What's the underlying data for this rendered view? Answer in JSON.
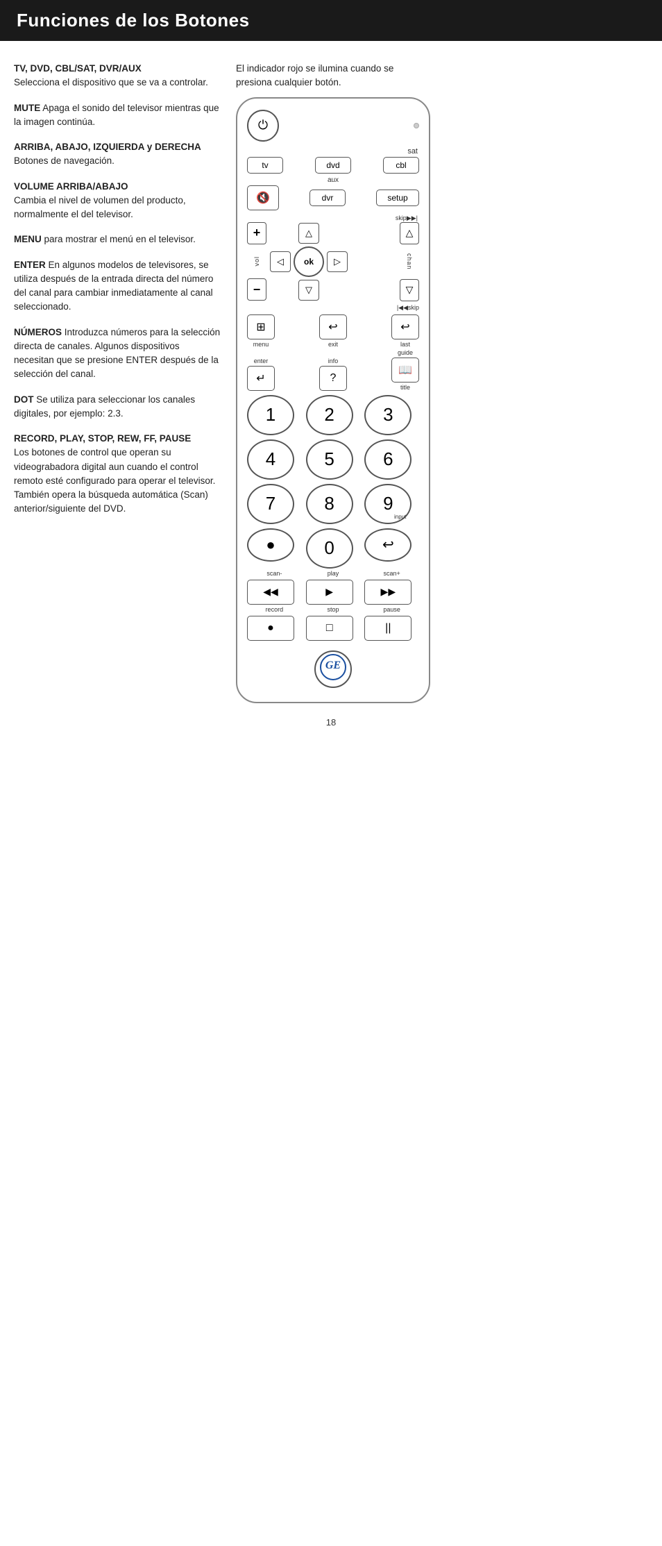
{
  "header": {
    "title": "Funciones de los Botones",
    "bg": "#1a1a1a",
    "color": "#ffffff"
  },
  "indicator_text": "El indicador rojo se ilumina cuando se presiona cualquier botón.",
  "descriptions": [
    {
      "label": "TV, DVD, CBL/SAT, DVR/AUX",
      "text": "Selecciona el dispositivo que se va a controlar."
    },
    {
      "label": "MUTE",
      "text": "Apaga el sonido del televisor mientras que la imagen continúa."
    },
    {
      "label": "ARRIBA, ABAJO, IZQUIERDA y DERECHA",
      "text": "Botones de navegación."
    },
    {
      "label": "VOLUME ARRIBA/ABAJO",
      "text": "Cambia el nivel de volumen del producto, normalmente el del televisor."
    },
    {
      "label": "MENU",
      "text": "para mostrar el menú en el televisor."
    },
    {
      "label": "ENTER",
      "text": "En algunos modelos de televisores, se utiliza después de la entrada directa del número del canal para cambiar inmediatamente al canal seleccionado."
    },
    {
      "label": "NÚMEROS",
      "text": "Introduzca números para la selección directa de canales. Algunos dispositivos necesitan que se presione ENTER después de la selección del canal."
    },
    {
      "label": "DOT",
      "text": "Se utiliza para seleccionar los canales digitales, por ejemplo: 2.3."
    },
    {
      "label": "RECORD, PLAY, STOP, REW, FF, PAUSE",
      "text": "Los botones de control que operan su videograbadora digital aun cuando el control remoto esté configurado para operar el televisor. También opera la búsqueda automática (Scan) anterior/siguiente del DVD."
    }
  ],
  "remote": {
    "power_icon": "⏻",
    "tv_label": "tv",
    "dvd_label": "dvd",
    "cbl_label": "cbl",
    "sat_label": "sat",
    "aux_label": "aux",
    "dvr_label": "dvr",
    "setup_label": "setup",
    "mute_icon": "🔇",
    "skip_label": "skip▶▶|",
    "vol_label": "vol",
    "chan_label": "chan",
    "plus_icon": "+",
    "minus_icon": "−",
    "up_arrow": "△",
    "down_arrow": "▽",
    "left_arrow": "◁",
    "right_arrow": "▷",
    "ok_label": "ok",
    "chan_up_icon": "△",
    "chan_down_icon": "▽",
    "iskip_label": "|◀◀skip",
    "menu_label": "menu",
    "exit_label": "exit",
    "last_label": "last",
    "enter_icon": "⊞",
    "enter_label": "enter",
    "back_icon": "↩",
    "info_icon": "?",
    "info_label": "info",
    "guide_icon": "□",
    "guide_label": "guide",
    "title_label": "title",
    "num1": "1",
    "num2": "2",
    "num3": "3",
    "num4": "4",
    "num5": "5",
    "num6": "6",
    "num7": "7",
    "num8": "8",
    "num9": "9",
    "num9_sub": "input",
    "dot_icon": "●",
    "num0": "0",
    "scan_back_icon": "↩",
    "scan_minus_label": "scan-",
    "play_label": "play",
    "scan_plus_label": "scan+",
    "rew_icon": "◀◀",
    "play_icon": "▶",
    "ff_icon": "▶▶",
    "record_label": "record",
    "stop_label": "stop",
    "pause_label": "pause",
    "rec_icon": "●",
    "stop_icon": "□",
    "pause_icon": "||",
    "ge_logo": "GE"
  },
  "page_number": "18"
}
